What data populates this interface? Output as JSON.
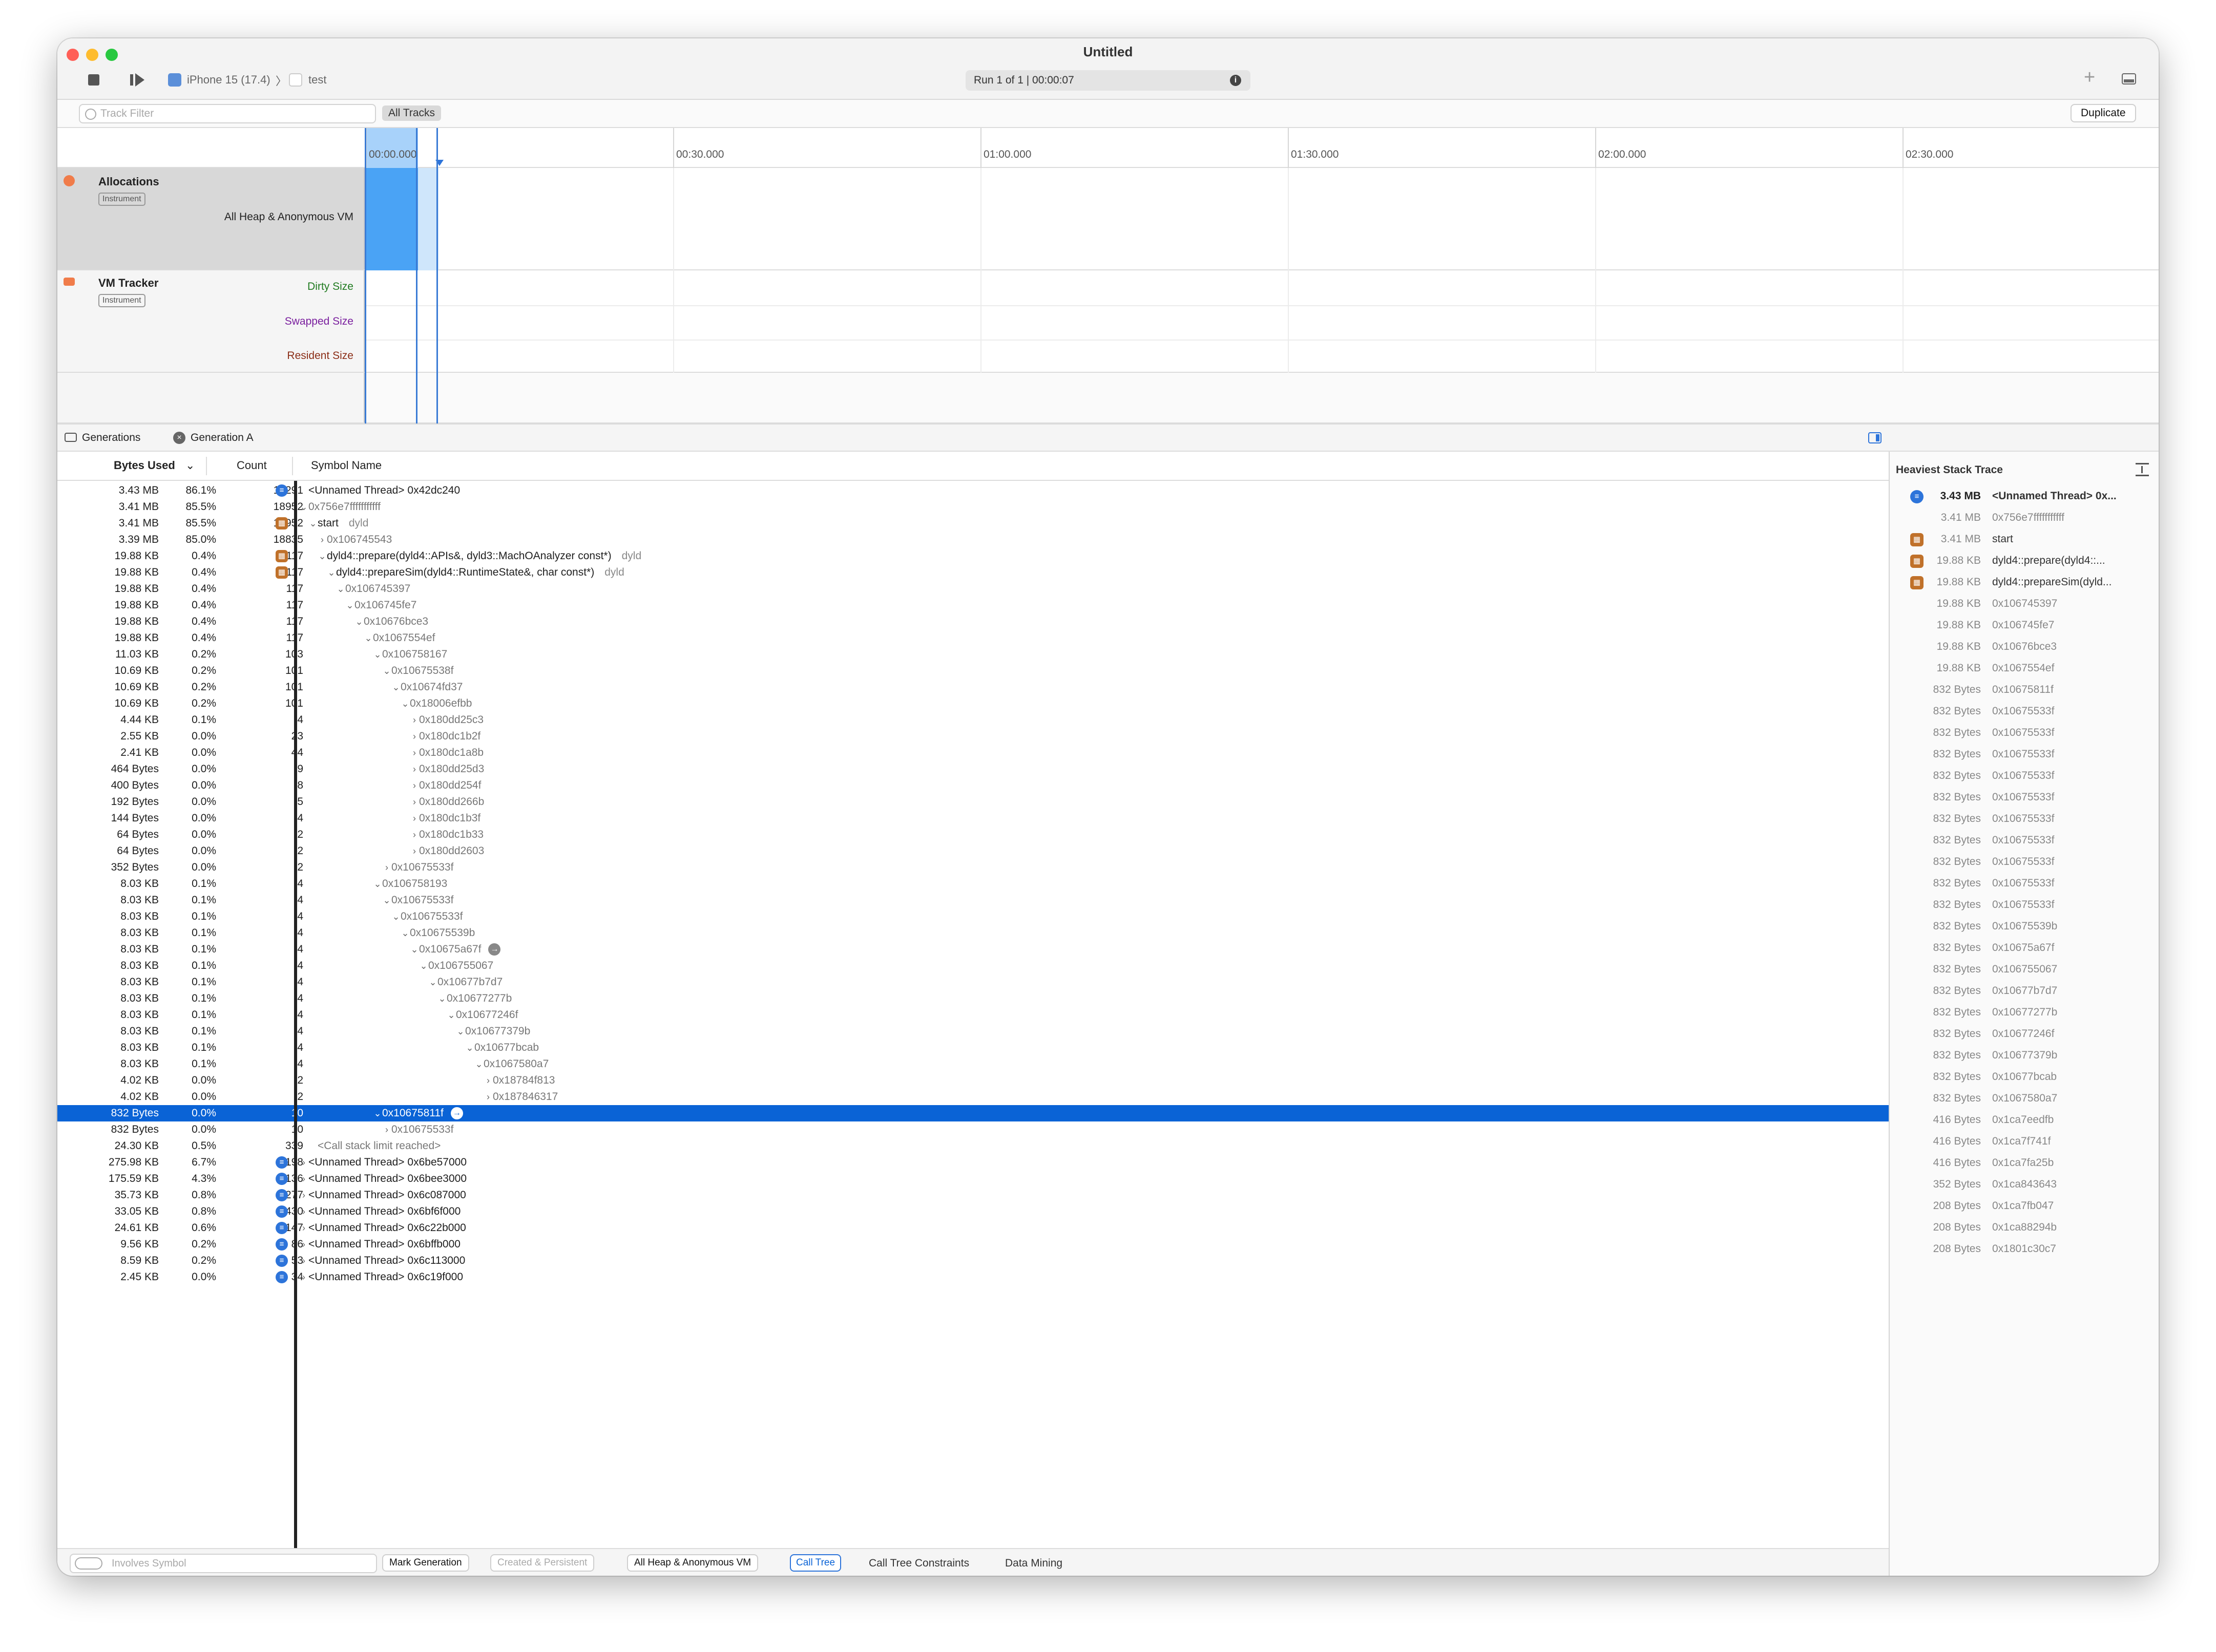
{
  "window": {
    "title": "Untitled"
  },
  "toolbar": {
    "device": "iPhone 15 (17.4)",
    "target": "test",
    "run_info": "Run 1 of 1  |  00:00:07",
    "info_glyph": "i",
    "add_glyph": "+"
  },
  "filter": {
    "placeholder": "Track Filter",
    "all_tracks": "All Tracks",
    "duplicate": "Duplicate"
  },
  "timeline": {
    "ticks": [
      "00:00.000",
      "00:30.000",
      "01:00.000",
      "01:30.000",
      "02:00.000",
      "02:30.000"
    ]
  },
  "tracks": {
    "allocations": {
      "name": "Allocations",
      "badge": "Instrument",
      "sub": "All Heap & Anonymous VM"
    },
    "vm_tracker": {
      "name": "VM Tracker",
      "badge": "Instrument",
      "sub": [
        "Dirty Size",
        "Swapped Size",
        "Resident Size"
      ]
    }
  },
  "detail_bar": {
    "generations": "Generations",
    "generation": "Generation A"
  },
  "columns": {
    "bytes": "Bytes Used",
    "count": "Count",
    "symbol": "Symbol Name"
  },
  "rows": [
    {
      "b": "3.43 MB",
      "p": "86.1%",
      "c": "19291",
      "i": "blue",
      "d": 0,
      "x": "none",
      "s": "<Unnamed Thread> 0x42dc240",
      "t": "sym"
    },
    {
      "b": "3.41 MB",
      "p": "85.5%",
      "c": "18952",
      "i": "",
      "d": 0,
      "x": "open",
      "s": "0x756e7fffffffffff",
      "t": "addr"
    },
    {
      "b": "3.41 MB",
      "p": "85.5%",
      "c": "18952",
      "i": "brown",
      "d": 1,
      "x": "open",
      "s": "start",
      "l": "dyld",
      "t": "sym"
    },
    {
      "b": "3.39 MB",
      "p": "85.0%",
      "c": "18835",
      "i": "",
      "d": 2,
      "x": "closed",
      "s": "0x106745543",
      "t": "addr"
    },
    {
      "b": "19.88 KB",
      "p": "0.4%",
      "c": "117",
      "i": "brown",
      "d": 2,
      "x": "open",
      "s": "dyld4::prepare(dyld4::APIs&, dyld3::MachOAnalyzer const*)",
      "l": "dyld",
      "t": "sym"
    },
    {
      "b": "19.88 KB",
      "p": "0.4%",
      "c": "117",
      "i": "brown",
      "d": 3,
      "x": "open",
      "s": "dyld4::prepareSim(dyld4::RuntimeState&, char const*)",
      "l": "dyld",
      "t": "sym"
    },
    {
      "b": "19.88 KB",
      "p": "0.4%",
      "c": "117",
      "i": "",
      "d": 4,
      "x": "open",
      "s": "0x106745397",
      "t": "addr"
    },
    {
      "b": "19.88 KB",
      "p": "0.4%",
      "c": "117",
      "i": "",
      "d": 5,
      "x": "open",
      "s": "0x106745fe7",
      "t": "addr"
    },
    {
      "b": "19.88 KB",
      "p": "0.4%",
      "c": "117",
      "i": "",
      "d": 6,
      "x": "open",
      "s": "0x10676bce3",
      "t": "addr"
    },
    {
      "b": "19.88 KB",
      "p": "0.4%",
      "c": "117",
      "i": "",
      "d": 7,
      "x": "open",
      "s": "0x1067554ef",
      "t": "addr"
    },
    {
      "b": "11.03 KB",
      "p": "0.2%",
      "c": "103",
      "i": "",
      "d": 8,
      "x": "open",
      "s": "0x106758167",
      "t": "addr"
    },
    {
      "b": "10.69 KB",
      "p": "0.2%",
      "c": "101",
      "i": "",
      "d": 9,
      "x": "open",
      "s": "0x10675538f",
      "t": "addr"
    },
    {
      "b": "10.69 KB",
      "p": "0.2%",
      "c": "101",
      "i": "",
      "d": 10,
      "x": "open",
      "s": "0x10674fd37",
      "t": "addr"
    },
    {
      "b": "10.69 KB",
      "p": "0.2%",
      "c": "101",
      "i": "",
      "d": 11,
      "x": "open",
      "s": "0x18006efbb",
      "t": "addr"
    },
    {
      "b": "4.44 KB",
      "p": "0.1%",
      "c": "4",
      "i": "",
      "d": 12,
      "x": "closed",
      "s": "0x180dd25c3",
      "t": "addr"
    },
    {
      "b": "2.55 KB",
      "p": "0.0%",
      "c": "23",
      "i": "",
      "d": 12,
      "x": "closed",
      "s": "0x180dc1b2f",
      "t": "addr"
    },
    {
      "b": "2.41 KB",
      "p": "0.0%",
      "c": "44",
      "i": "",
      "d": 12,
      "x": "closed",
      "s": "0x180dc1a8b",
      "t": "addr"
    },
    {
      "b": "464 Bytes",
      "p": "0.0%",
      "c": "9",
      "i": "",
      "d": 12,
      "x": "closed",
      "s": "0x180dd25d3",
      "t": "addr"
    },
    {
      "b": "400 Bytes",
      "p": "0.0%",
      "c": "8",
      "i": "",
      "d": 12,
      "x": "closed",
      "s": "0x180dd254f",
      "t": "addr"
    },
    {
      "b": "192 Bytes",
      "p": "0.0%",
      "c": "5",
      "i": "",
      "d": 12,
      "x": "closed",
      "s": "0x180dd266b",
      "t": "addr"
    },
    {
      "b": "144 Bytes",
      "p": "0.0%",
      "c": "4",
      "i": "",
      "d": 12,
      "x": "closed",
      "s": "0x180dc1b3f",
      "t": "addr"
    },
    {
      "b": "64 Bytes",
      "p": "0.0%",
      "c": "2",
      "i": "",
      "d": 12,
      "x": "closed",
      "s": "0x180dc1b33",
      "t": "addr"
    },
    {
      "b": "64 Bytes",
      "p": "0.0%",
      "c": "2",
      "i": "",
      "d": 12,
      "x": "closed",
      "s": "0x180dd2603",
      "t": "addr"
    },
    {
      "b": "352 Bytes",
      "p": "0.0%",
      "c": "2",
      "i": "",
      "d": 9,
      "x": "closed",
      "s": "0x10675533f",
      "t": "addr"
    },
    {
      "b": "8.03 KB",
      "p": "0.1%",
      "c": "4",
      "i": "",
      "d": 8,
      "x": "open",
      "s": "0x106758193",
      "t": "addr"
    },
    {
      "b": "8.03 KB",
      "p": "0.1%",
      "c": "4",
      "i": "",
      "d": 9,
      "x": "open",
      "s": "0x10675533f",
      "t": "addr"
    },
    {
      "b": "8.03 KB",
      "p": "0.1%",
      "c": "4",
      "i": "",
      "d": 10,
      "x": "open",
      "s": "0x10675533f",
      "t": "addr"
    },
    {
      "b": "8.03 KB",
      "p": "0.1%",
      "c": "4",
      "i": "",
      "d": 11,
      "x": "open",
      "s": "0x10675539b",
      "t": "addr"
    },
    {
      "b": "8.03 KB",
      "p": "0.1%",
      "c": "4",
      "i": "",
      "d": 12,
      "x": "open",
      "s": "0x10675a67f",
      "t": "addr",
      "arrow": true
    },
    {
      "b": "8.03 KB",
      "p": "0.1%",
      "c": "4",
      "i": "",
      "d": 13,
      "x": "open",
      "s": "0x106755067",
      "t": "addr"
    },
    {
      "b": "8.03 KB",
      "p": "0.1%",
      "c": "4",
      "i": "",
      "d": 14,
      "x": "open",
      "s": "0x10677b7d7",
      "t": "addr"
    },
    {
      "b": "8.03 KB",
      "p": "0.1%",
      "c": "4",
      "i": "",
      "d": 15,
      "x": "open",
      "s": "0x10677277b",
      "t": "addr"
    },
    {
      "b": "8.03 KB",
      "p": "0.1%",
      "c": "4",
      "i": "",
      "d": 16,
      "x": "open",
      "s": "0x10677246f",
      "t": "addr"
    },
    {
      "b": "8.03 KB",
      "p": "0.1%",
      "c": "4",
      "i": "",
      "d": 17,
      "x": "open",
      "s": "0x10677379b",
      "t": "addr"
    },
    {
      "b": "8.03 KB",
      "p": "0.1%",
      "c": "4",
      "i": "",
      "d": 18,
      "x": "open",
      "s": "0x10677bcab",
      "t": "addr"
    },
    {
      "b": "8.03 KB",
      "p": "0.1%",
      "c": "4",
      "i": "",
      "d": 19,
      "x": "open",
      "s": "0x1067580a7",
      "t": "addr"
    },
    {
      "b": "4.02 KB",
      "p": "0.0%",
      "c": "2",
      "i": "",
      "d": 20,
      "x": "closed",
      "s": "0x18784f813",
      "t": "addr"
    },
    {
      "b": "4.02 KB",
      "p": "0.0%",
      "c": "2",
      "i": "",
      "d": 20,
      "x": "closed",
      "s": "0x187846317",
      "t": "addr"
    },
    {
      "b": "832 Bytes",
      "p": "0.0%",
      "c": "10",
      "i": "",
      "d": 8,
      "x": "open",
      "s": "0x10675811f",
      "t": "addr",
      "arrow": true,
      "sel": true
    },
    {
      "b": "832 Bytes",
      "p": "0.0%",
      "c": "10",
      "i": "",
      "d": 9,
      "x": "closed",
      "s": "0x10675533f",
      "t": "addr"
    },
    {
      "b": "24.30 KB",
      "p": "0.5%",
      "c": "339",
      "i": "",
      "d": 1,
      "x": "none",
      "s": "<Call stack limit reached>",
      "t": "addr"
    },
    {
      "b": "275.98 KB",
      "p": "6.7%",
      "c": "198",
      "i": "blue",
      "d": 0,
      "x": "closed",
      "s": "<Unnamed Thread> 0x6be57000",
      "t": "sym"
    },
    {
      "b": "175.59 KB",
      "p": "4.3%",
      "c": "1136",
      "i": "blue",
      "d": 0,
      "x": "closed",
      "s": "<Unnamed Thread> 0x6bee3000",
      "t": "sym"
    },
    {
      "b": "35.73 KB",
      "p": "0.8%",
      "c": "277",
      "i": "blue",
      "d": 0,
      "x": "closed",
      "s": "<Unnamed Thread> 0x6c087000",
      "t": "sym"
    },
    {
      "b": "33.05 KB",
      "p": "0.8%",
      "c": "430",
      "i": "blue",
      "d": 0,
      "x": "closed",
      "s": "<Unnamed Thread> 0x6bf6f000",
      "t": "sym"
    },
    {
      "b": "24.61 KB",
      "p": "0.6%",
      "c": "147",
      "i": "blue",
      "d": 0,
      "x": "closed",
      "s": "<Unnamed Thread> 0x6c22b000",
      "t": "sym"
    },
    {
      "b": "9.56 KB",
      "p": "0.2%",
      "c": "86",
      "i": "blue",
      "d": 0,
      "x": "closed",
      "s": "<Unnamed Thread> 0x6bffb000",
      "t": "sym"
    },
    {
      "b": "8.59 KB",
      "p": "0.2%",
      "c": "53",
      "i": "blue",
      "d": 0,
      "x": "closed",
      "s": "<Unnamed Thread> 0x6c113000",
      "t": "sym"
    },
    {
      "b": "2.45 KB",
      "p": "0.0%",
      "c": "34",
      "i": "blue",
      "d": 0,
      "x": "closed",
      "s": "<Unnamed Thread> 0x6c19f000",
      "t": "sym"
    }
  ],
  "heaviest": {
    "title": "Heaviest Stack Trace",
    "rows": [
      {
        "b": "3.43 MB",
        "s": "<Unnamed Thread> 0x...",
        "i": "blue",
        "strong": true
      },
      {
        "b": "3.41 MB",
        "s": "0x756e7fffffffffff",
        "i": ""
      },
      {
        "b": "3.41 MB",
        "s": "start",
        "i": "brown"
      },
      {
        "b": "19.88 KB",
        "s": "dyld4::prepare(dyld4::...",
        "i": "brown"
      },
      {
        "b": "19.88 KB",
        "s": "dyld4::prepareSim(dyld...",
        "i": "brown"
      },
      {
        "b": "19.88 KB",
        "s": "0x106745397",
        "i": ""
      },
      {
        "b": "19.88 KB",
        "s": "0x106745fe7",
        "i": ""
      },
      {
        "b": "19.88 KB",
        "s": "0x10676bce3",
        "i": ""
      },
      {
        "b": "19.88 KB",
        "s": "0x1067554ef",
        "i": ""
      },
      {
        "b": "832 Bytes",
        "s": "0x10675811f",
        "i": ""
      },
      {
        "b": "832 Bytes",
        "s": "0x10675533f",
        "i": ""
      },
      {
        "b": "832 Bytes",
        "s": "0x10675533f",
        "i": ""
      },
      {
        "b": "832 Bytes",
        "s": "0x10675533f",
        "i": ""
      },
      {
        "b": "832 Bytes",
        "s": "0x10675533f",
        "i": ""
      },
      {
        "b": "832 Bytes",
        "s": "0x10675533f",
        "i": ""
      },
      {
        "b": "832 Bytes",
        "s": "0x10675533f",
        "i": ""
      },
      {
        "b": "832 Bytes",
        "s": "0x10675533f",
        "i": ""
      },
      {
        "b": "832 Bytes",
        "s": "0x10675533f",
        "i": ""
      },
      {
        "b": "832 Bytes",
        "s": "0x10675533f",
        "i": ""
      },
      {
        "b": "832 Bytes",
        "s": "0x10675533f",
        "i": ""
      },
      {
        "b": "832 Bytes",
        "s": "0x10675539b",
        "i": ""
      },
      {
        "b": "832 Bytes",
        "s": "0x10675a67f",
        "i": ""
      },
      {
        "b": "832 Bytes",
        "s": "0x106755067",
        "i": ""
      },
      {
        "b": "832 Bytes",
        "s": "0x10677b7d7",
        "i": ""
      },
      {
        "b": "832 Bytes",
        "s": "0x10677277b",
        "i": ""
      },
      {
        "b": "832 Bytes",
        "s": "0x10677246f",
        "i": ""
      },
      {
        "b": "832 Bytes",
        "s": "0x10677379b",
        "i": ""
      },
      {
        "b": "832 Bytes",
        "s": "0x10677bcab",
        "i": ""
      },
      {
        "b": "832 Bytes",
        "s": "0x1067580a7",
        "i": ""
      },
      {
        "b": "416 Bytes",
        "s": "0x1ca7eedfb",
        "i": ""
      },
      {
        "b": "416 Bytes",
        "s": "0x1ca7f741f",
        "i": ""
      },
      {
        "b": "416 Bytes",
        "s": "0x1ca7fa25b",
        "i": ""
      },
      {
        "b": "352 Bytes",
        "s": "0x1ca843643",
        "i": ""
      },
      {
        "b": "208 Bytes",
        "s": "0x1ca7fb047",
        "i": ""
      },
      {
        "b": "208 Bytes",
        "s": "0x1ca88294b",
        "i": ""
      },
      {
        "b": "208 Bytes",
        "s": "0x1801c30c7",
        "i": ""
      }
    ]
  },
  "bottom": {
    "involves_placeholder": "Involves Symbol",
    "mark_generation": "Mark Generation",
    "created_persistent": "Created & Persistent",
    "heap_select": "All Heap & Anonymous VM",
    "call_tree": "Call Tree",
    "constraints": "Call Tree Constraints",
    "data_mining": "Data Mining"
  },
  "colors": {
    "accent": "#0a63d6",
    "selection": "#3a9df5",
    "dirty": "#1f7a1f",
    "swapped": "#7a1f9e",
    "resident": "#8b2d16"
  }
}
